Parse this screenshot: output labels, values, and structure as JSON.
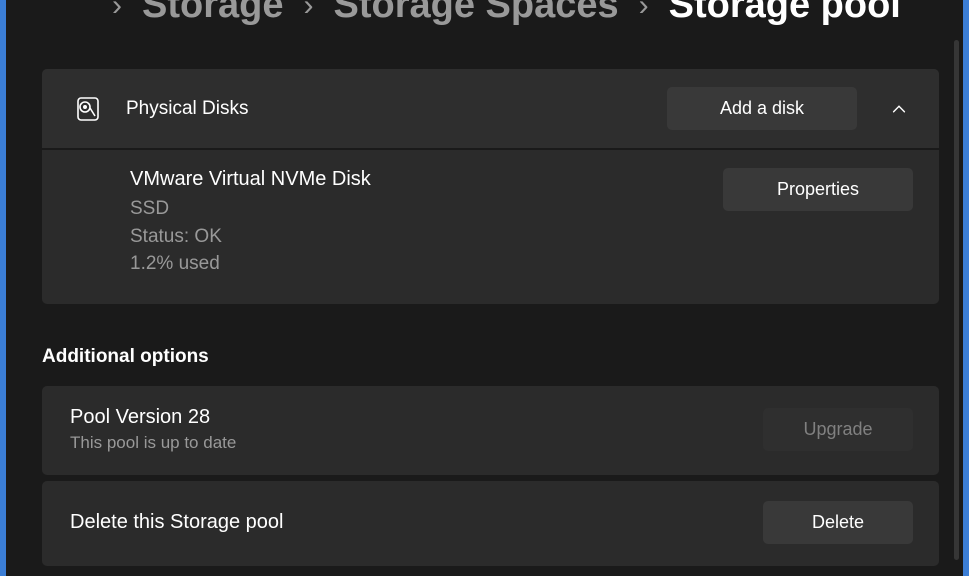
{
  "breadcrumb": {
    "item1": "Storage",
    "item2": "Storage Spaces",
    "current": "Storage pool"
  },
  "physical_disks": {
    "header_label": "Physical Disks",
    "add_button": "Add a disk",
    "disk": {
      "name": "VMware Virtual NVMe Disk",
      "type": "SSD",
      "status": "Status: OK",
      "usage": "1.2% used"
    },
    "properties_button": "Properties"
  },
  "additional": {
    "section_title": "Additional options",
    "version": {
      "title": "Pool Version 28",
      "subtitle": "This pool is up to date",
      "button": "Upgrade"
    },
    "delete": {
      "title": "Delete this Storage pool",
      "button": "Delete"
    }
  }
}
